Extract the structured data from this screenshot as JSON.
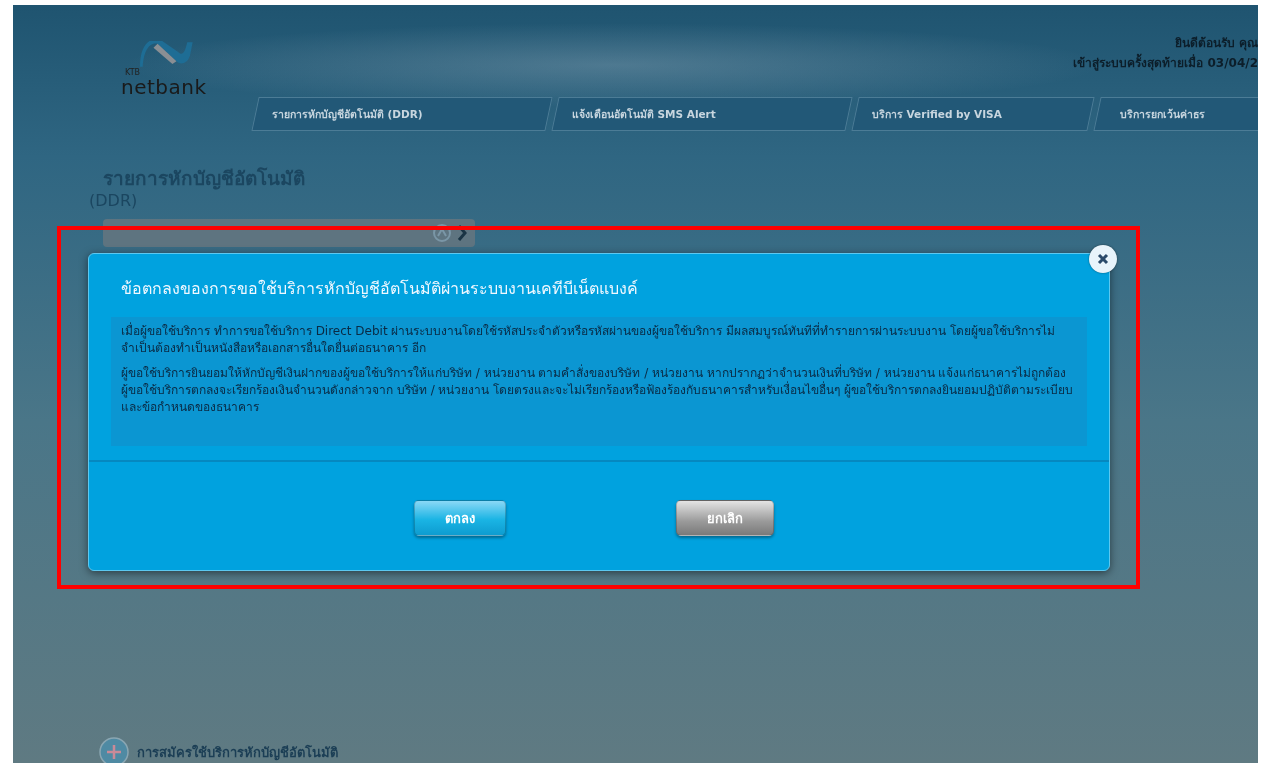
{
  "header": {
    "logo": {
      "small": "KTB",
      "brand": "netbank"
    },
    "welcome": [
      "ยินดีต้อนรับ คุณ",
      "เข้าสู่ระบบครั้งสุดท้ายเมื่อ 03/04/2"
    ],
    "tabs": [
      {
        "label": "รายการหักบัญชีอัตโนมัติ (DDR)"
      },
      {
        "label": "แจ้งเตือนอัตโนมัติ SMS Alert"
      },
      {
        "label": "บริการ Verified by VISA"
      },
      {
        "label": "บริการยกเว้นค่าธร"
      }
    ]
  },
  "page": {
    "title": "รายการหักบัญชีอัตโนมัติ",
    "subtitle": "(DDR)",
    "register_link": "การสมัครใช้บริการหักบัญชีอัตโนมัติ"
  },
  "dialog": {
    "title": "ข้อตกลงของการขอใช้บริการหักบัญชีอัตโนมัติผ่านระบบงานเคทีบีเน็ตแบงค์",
    "paragraphs": [
      "เมื่อผู้ขอใช้บริการ ทำการขอใช้บริการ Direct Debit ผ่านระบบงานโดยใช้รหัสประจำตัวหรือรหัสผ่านของผู้ขอใช้บริการ มีผลสมบูรณ์ทันทีที่ทำรายการผ่านระบบงาน โดยผู้ขอใช้บริการไม่จำเป็นต้องทำเป็นหนังสือหรือเอกสารอื่นใดยื่นต่อธนาคาร อีก",
      "ผู้ขอใช้บริการยินยอมให้หักบัญชีเงินฝากของผู้ขอใช้บริการให้แก่บริษัท / หน่วยงาน ตามคำสั่งของบริษัท / หน่วยงาน หากปรากฏว่าจำนวนเงินที่บริษัท / หน่วยงาน แจ้งแก่ธนาคารไม่ถูกต้อง ผู้ขอใช้บริการตกลงจะเรียกร้องเงินจำนวนดังกล่าวจาก บริษัท / หน่วยงาน โดยตรงและจะไม่เรียกร้องหรือฟ้องร้องกับธนาคารสำหรับเงื่อนไขอื่นๆ ผู้ขอใช้บริการตกลงยินยอมปฏิบัติตามระเบียบและข้อกำหนดของธนาคาร"
    ],
    "buttons": [
      {
        "label": "ตกลง",
        "kind": "primary"
      },
      {
        "label": "ยกเลิก",
        "kind": "secondary"
      }
    ]
  }
}
